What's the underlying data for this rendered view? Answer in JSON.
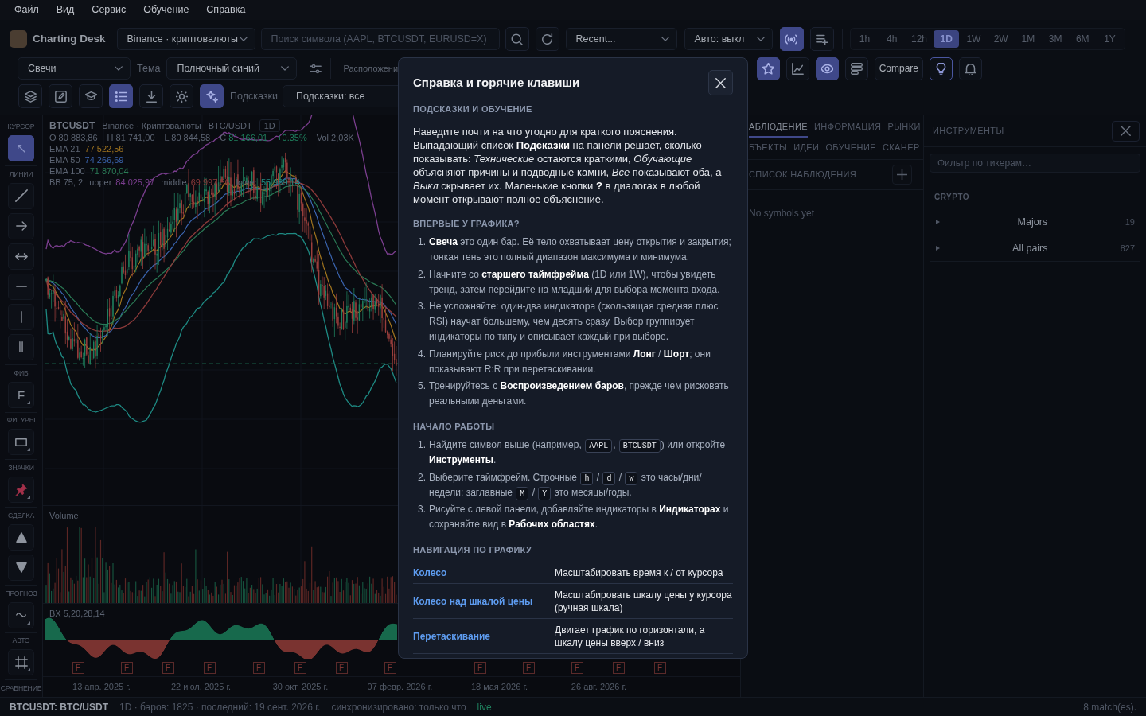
{
  "menu_bar": {
    "items": [
      "Файл",
      "Вид",
      "Сервис",
      "Обучение",
      "Справка"
    ]
  },
  "toolbar": {
    "app_title": "Charting Desk",
    "exchange_select": "Binance · криптовалюты",
    "symbol_search": {
      "placeholder": "Поиск символа (AAPL, BTCUSDT, EURUSD=X)"
    },
    "search_buttons": [
      {
        "kind": "search",
        "on": false
      },
      {
        "kind": "refresh",
        "on": false
      }
    ],
    "recent_select": "Recent...",
    "auto_select": "Авто: выкл",
    "feed_buttons": [
      {
        "kind": "broadcast",
        "on": true
      },
      {
        "kind": "playlist-add",
        "on": false
      }
    ],
    "timeframes": [
      {
        "label": "1h",
        "selected": false
      },
      {
        "label": "4h",
        "selected": false
      },
      {
        "label": "12h",
        "selected": false
      },
      {
        "label": "1D",
        "selected": true
      },
      {
        "label": "1W",
        "selected": false
      },
      {
        "label": "2W",
        "selected": false
      },
      {
        "label": "1M",
        "selected": false
      },
      {
        "label": "3M",
        "selected": false
      },
      {
        "label": "6M",
        "selected": false
      },
      {
        "label": "1Y",
        "selected": false
      }
    ],
    "chart_type_select": "Свечи",
    "theme_label": "Тема",
    "theme_select": "Полночный синий",
    "layout_label": "Расположени",
    "view_buttons": [
      {
        "kind": "star",
        "on": true,
        "highlighted": false
      },
      {
        "kind": "chart",
        "on": false,
        "highlighted": false
      },
      {
        "kind": "eye",
        "on": true,
        "highlighted": false
      },
      {
        "kind": "lines",
        "on": false,
        "highlighted": false
      },
      {
        "kind": "text",
        "label": "Compare",
        "on": false,
        "highlighted": false
      },
      {
        "kind": "bulb",
        "on": false,
        "highlighted": true
      },
      {
        "kind": "bell",
        "on": false,
        "highlighted": false
      }
    ],
    "tool_buttons": [
      {
        "kind": "layers",
        "on": false
      },
      {
        "kind": "edit",
        "on": false
      },
      {
        "kind": "cap",
        "on": false
      },
      {
        "kind": "list",
        "on": true
      },
      {
        "kind": "download",
        "on": false
      },
      {
        "kind": "sun",
        "on": false
      },
      {
        "kind": "sparkle",
        "on": true
      }
    ],
    "hints_label": "Подсказки",
    "hints_select": "Подсказки: все"
  },
  "tool_rail": {
    "sections": [
      {
        "label": "КУРСОР",
        "tools": [
          {
            "kind": "cursor",
            "selected": true,
            "submenu": false
          }
        ]
      },
      {
        "label": "ЛИНИИ",
        "tools": [
          {
            "kind": "line",
            "selected": false,
            "submenu": false
          },
          {
            "kind": "arrow",
            "selected": false,
            "submenu": false
          },
          {
            "kind": "double-arrow",
            "selected": false,
            "submenu": false
          },
          {
            "kind": "horizontal",
            "selected": false,
            "submenu": false
          },
          {
            "kind": "vertical",
            "selected": false,
            "submenu": false
          },
          {
            "kind": "parallel",
            "selected": false,
            "submenu": false
          }
        ]
      },
      {
        "label": "ФИБ",
        "tools": [
          {
            "kind": "fib",
            "label": "F",
            "selected": false,
            "submenu": true
          }
        ]
      },
      {
        "label": "ФИГУРЫ",
        "tools": [
          {
            "kind": "rect",
            "selected": false,
            "submenu": true
          }
        ]
      },
      {
        "label": "ЗНАЧКИ",
        "tools": [
          {
            "kind": "pin",
            "selected": false,
            "submenu": true
          }
        ]
      },
      {
        "label": "СДЕЛКА",
        "tools": [
          {
            "kind": "long",
            "selected": false,
            "submenu": false
          },
          {
            "kind": "short",
            "selected": false,
            "submenu": false
          }
        ]
      },
      {
        "label": "ПРОГНОЗ",
        "tools": [
          {
            "kind": "forecast",
            "selected": false,
            "submenu": true
          }
        ]
      },
      {
        "label": "АВТО",
        "tools": [
          {
            "kind": "auto",
            "selected": false,
            "submenu": true
          }
        ]
      },
      {
        "label": "СРАВНЕНИЕ"
      }
    ]
  },
  "chart": {
    "legend": {
      "symbol": "BTCUSDT",
      "exchange": "Binance · Криптовалюты",
      "pair": "BTC/USDT",
      "interval": "1D",
      "prices": [
        {
          "label": "O",
          "value": "80 883,86"
        },
        {
          "label": "H",
          "value": "81 741,00"
        },
        {
          "label": "L",
          "value": "80 844,58"
        }
      ],
      "close": {
        "label": "C",
        "value": "81 166,01"
      },
      "change": "+0.35%",
      "volume": "Vol 2,03K",
      "indicators": [
        {
          "name": "EMA 21",
          "value": "77 522,56",
          "color": "#a0741f"
        },
        {
          "name": "EMA 50",
          "value": "74 266,69",
          "color": "#3b65b0"
        },
        {
          "name": "EMA 100",
          "value": "71 870,04",
          "color": "#2a7a55"
        }
      ],
      "bands": {
        "name": "BB 75, 2",
        "lines": [
          {
            "label": "upper",
            "value": "84 025,97",
            "color": "#7a3e8e"
          },
          {
            "label": "middle",
            "value": "69 997,56",
            "color": "#8c3a3a"
          },
          {
            "label": "lower",
            "value": "55 989,14",
            "color": "#1e8a83"
          }
        ]
      }
    },
    "volume_pane": {
      "label": "Volume"
    },
    "oscillator_pane": {
      "label": "BX 5,20,28,14",
      "markers": [
        {
          "label": "F"
        },
        {
          "label": "F"
        },
        {
          "label": "F"
        },
        {
          "label": "F"
        },
        {
          "label": "F"
        },
        {
          "label": "F"
        },
        {
          "label": "F"
        },
        {
          "label": "F"
        },
        {
          "label": "F"
        },
        {
          "label": "F"
        },
        {
          "label": "F"
        },
        {
          "label": "F"
        },
        {
          "label": "F"
        }
      ]
    },
    "x_axis": {
      "labels": [
        "13 апр. 2025 г.",
        "22 июл. 2025 г.",
        "30 окт. 2025 г.",
        "07 февр. 2026 г.",
        "18 мая 2026 г.",
        "26 авг. 2026 г."
      ]
    }
  },
  "help_dialog": {
    "title": "Справка и горячие клавиши",
    "sections": [
      {
        "kind": "paragraph",
        "heading": "ПОДСКАЗКИ И ОБУЧЕНИЕ",
        "text": "Наведите почти на что угодно для краткого пояснения. Выпадающий список **Подсказки** на панели решает, сколько показывать: *Технические* остаются краткими, *Обучающие* объясняют причины и подводные камни, *Все* показывают оба, а *Выкл* скрывает их. Маленькие кнопки **?** в диалогах в любой момент открывают полное объяснение."
      },
      {
        "kind": "list",
        "heading": "ВПЕРВЫЕ У ГРАФИКА?",
        "items": [
          {
            "number": "1.",
            "parts": [
              {
                "kind": "text",
                "text": "**Свеча** это один бар. Её тело охватывает цену открытия и закрытия; тонкая тень это полный диапазон максимума и минимума."
              }
            ]
          },
          {
            "number": "2.",
            "parts": [
              {
                "kind": "text",
                "text": "Начните со **старшего таймфрейма** (1D или 1W), чтобы увидеть тренд, затем перейдите на младший для выбора момента входа."
              }
            ]
          },
          {
            "number": "3.",
            "parts": [
              {
                "kind": "text",
                "text": "Не усложняйте: один-два индикатора (скользящая средняя плюс RSI) научат большему, чем десять сразу. Выбор группирует индикаторы по типу и описывает каждый при выборе."
              }
            ]
          },
          {
            "number": "4.",
            "parts": [
              {
                "kind": "text",
                "text": "Планируйте риск до прибыли инструментами **Лонг** / **Шорт**; они показывают R:R при перетаскивании."
              }
            ]
          },
          {
            "number": "5.",
            "parts": [
              {
                "kind": "text",
                "text": "Тренируйтесь с **Воспроизведением баров**, прежде чем рисковать реальными деньгами."
              }
            ]
          }
        ]
      },
      {
        "kind": "list",
        "heading": "НАЧАЛО РАБОТЫ",
        "items": [
          {
            "number": "1.",
            "parts": [
              {
                "kind": "text",
                "text": "Найдите символ выше (например, "
              },
              {
                "kind": "kbd",
                "text": "AAPL"
              },
              {
                "kind": "text",
                "text": ", "
              },
              {
                "kind": "kbd",
                "text": "BTCUSDT"
              },
              {
                "kind": "text",
                "text": ") или откройте **Инструменты**."
              }
            ]
          },
          {
            "number": "2.",
            "parts": [
              {
                "kind": "text",
                "text": "Выберите таймфрейм. Строчные "
              },
              {
                "kind": "kbd",
                "text": "h"
              },
              {
                "kind": "text",
                "text": " / "
              },
              {
                "kind": "kbd",
                "text": "d"
              },
              {
                "kind": "text",
                "text": " / "
              },
              {
                "kind": "kbd",
                "text": "w"
              },
              {
                "kind": "text",
                "text": " это часы/дни/недели; заглавные "
              },
              {
                "kind": "kbd",
                "text": "M"
              },
              {
                "kind": "text",
                "text": " / "
              },
              {
                "kind": "kbd",
                "text": "Y"
              },
              {
                "kind": "text",
                "text": " это месяцы/годы."
              }
            ]
          },
          {
            "number": "3.",
            "parts": [
              {
                "kind": "text",
                "text": "Рисуйте с левой панели, добавляйте индикаторы в **Индикаторах** и сохраняйте вид в **Рабочих областях**."
              }
            ]
          }
        ]
      },
      {
        "kind": "table",
        "heading": "НАВИГАЦИЯ ПО ГРАФИКУ",
        "rows": [
          {
            "key": "Колесо",
            "description": "Масштабировать время к / от курсора"
          },
          {
            "key": "Колесо над шкалой цены",
            "description": "Масштабировать шкалу цены у курсора (ручная шкала)"
          },
          {
            "key": "Перетаскивание",
            "description": "Двигает график по горизонтали, а шкалу цены вверх / вниз"
          }
        ]
      }
    ]
  },
  "watch_panel": {
    "tab_rows": [
      {
        "tabs": [
          {
            "label": "АБЛЮДЕНИЕ",
            "selected": true
          },
          {
            "label": "ИНФОРМАЦИЯ",
            "selected": false
          },
          {
            "label": "РЫНКИ",
            "selected": false
          }
        ]
      },
      {
        "tabs": [
          {
            "label": "БЪЕКТЫ",
            "selected": false
          },
          {
            "label": "ИДЕИ",
            "selected": false
          },
          {
            "label": "ОБУЧЕНИЕ",
            "selected": false
          },
          {
            "label": "СКАНЕР",
            "selected": false
          }
        ]
      }
    ],
    "list_title": "СПИСОК НАБЛЮДЕНИЯ",
    "empty_text": "No symbols yet"
  },
  "instruments_panel": {
    "title": "ИНСТРУМЕНТЫ",
    "filter": {
      "placeholder": "Фильтр по тикерам…"
    },
    "groups": [
      {
        "label": "CRYPTO",
        "items": [
          {
            "name": "Majors",
            "count": "19",
            "expanded": false
          },
          {
            "name": "All pairs",
            "count": "827",
            "expanded": false
          }
        ]
      }
    ]
  },
  "status_bar": {
    "symbol": "BTCUSDT: BTC/USDT",
    "details": "1D · баров: 1825 · последний: 19 сент. 2026 г.",
    "sync": "синхронизировано: только что",
    "connection": "live",
    "matches": "8 match(es)."
  }
}
